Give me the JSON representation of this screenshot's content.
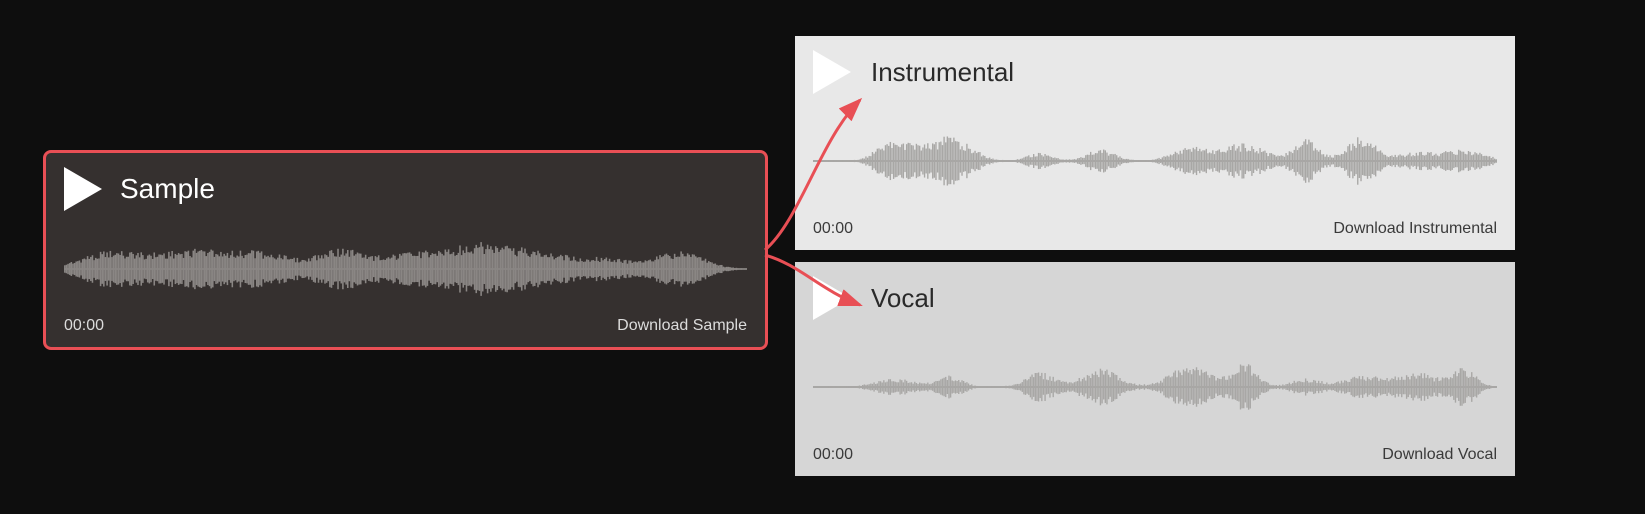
{
  "sample": {
    "title": "Sample",
    "time": "00:00",
    "download": "Download Sample"
  },
  "instrumental": {
    "title": "Instrumental",
    "time": "00:00",
    "download": "Download Instrumental"
  },
  "vocal": {
    "title": "Vocal",
    "time": "00:00",
    "download": "Download Vocal"
  },
  "colors": {
    "highlight": "#e84f55",
    "dark_bg": "#0e0e0e",
    "card_dark": "#35302f",
    "card_light1": "#e8e8e8",
    "card_light2": "#d6d6d6"
  }
}
